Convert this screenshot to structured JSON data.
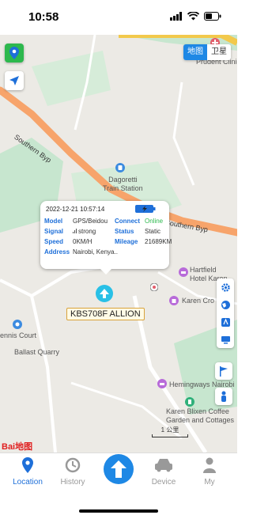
{
  "status_bar": {
    "time": "10:58",
    "icons": [
      "signal-icon",
      "wifi-icon",
      "battery-icon"
    ]
  },
  "map": {
    "map_type": {
      "options": [
        "地图",
        "卫星"
      ],
      "selected": "地图"
    },
    "labels": {
      "prudent_clinic": "Prudent Clinic",
      "dagoretti": "Dagoretti\nTrain Station",
      "hartfield": "Hartfield\nHotel Karen",
      "karen_cross": "Karen Cro",
      "tennis": "ennis Court",
      "ballast": "Ballast Quarry",
      "hemingways": "Hemingways Nairobi",
      "blixen": "Karen Blixen Coffee\nGarden and Cottages",
      "road_southern_1": "Southern Byp",
      "road_southern_2": "Southern Byp"
    },
    "scale": "1 公里",
    "logo": "Bai地图"
  },
  "popup": {
    "datetime": "2022-12-21 10:57:14",
    "rows": [
      {
        "k1": "Model",
        "v1": "GPS/Beidou",
        "k2": "Connect",
        "v2": "Online"
      },
      {
        "k1": "Signal",
        "v1": "strong",
        "k2": "Status",
        "v2": "Static"
      },
      {
        "k1": "Speed",
        "v1": "0KM/H",
        "k2": "Mileage",
        "v2": "21689KM"
      },
      {
        "k1": "Address",
        "v1": "Nairobi, Kenya.."
      }
    ]
  },
  "vehicle_plate": "KBS708F ALLION",
  "colors": {
    "accent": "#1e88e5",
    "online": "#2db84d",
    "road": "#f7a46b",
    "park": "#c7e6cf"
  },
  "tabs": [
    {
      "label": "Location",
      "icon": "location-pin-icon",
      "active": true
    },
    {
      "label": "History",
      "icon": "history-icon",
      "active": false
    },
    {
      "label": "",
      "icon": "arrow-up-icon",
      "active": false
    },
    {
      "label": "Device",
      "icon": "car-icon",
      "active": false
    },
    {
      "label": "My",
      "icon": "person-icon",
      "active": false
    }
  ]
}
